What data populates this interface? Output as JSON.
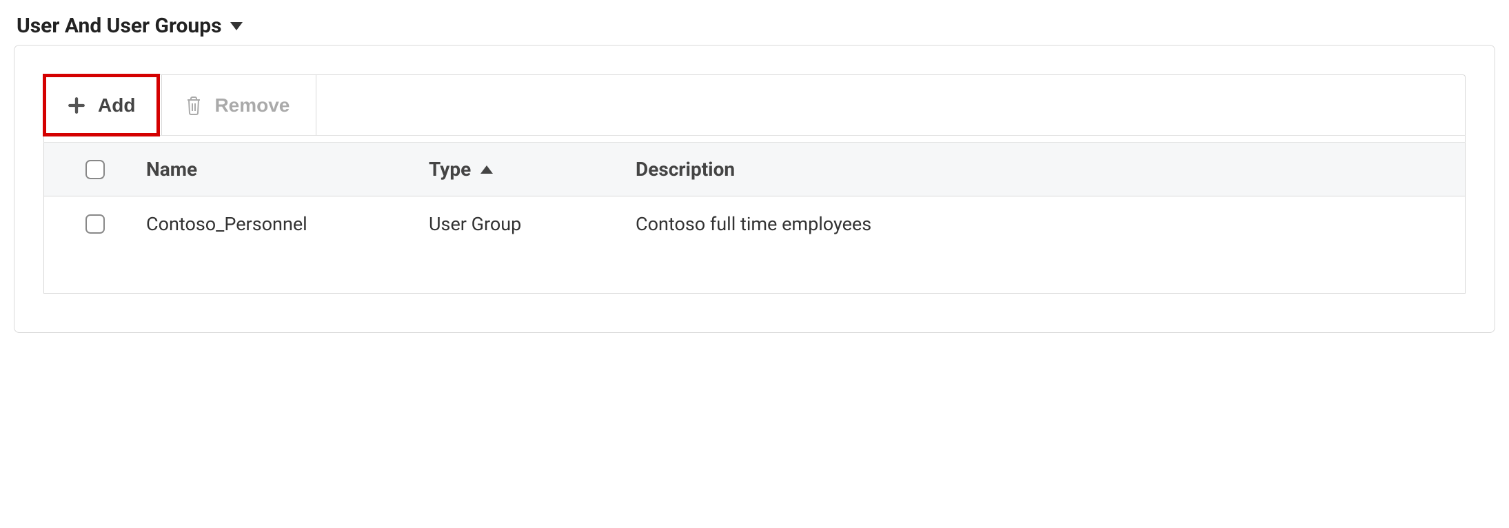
{
  "section": {
    "title": "User And User Groups"
  },
  "toolbar": {
    "add_label": "Add",
    "remove_label": "Remove"
  },
  "table": {
    "headers": {
      "name": "Name",
      "type": "Type",
      "description": "Description"
    },
    "rows": [
      {
        "name": "Contoso_Personnel",
        "type": "User Group",
        "description": "Contoso full time employees"
      }
    ]
  }
}
